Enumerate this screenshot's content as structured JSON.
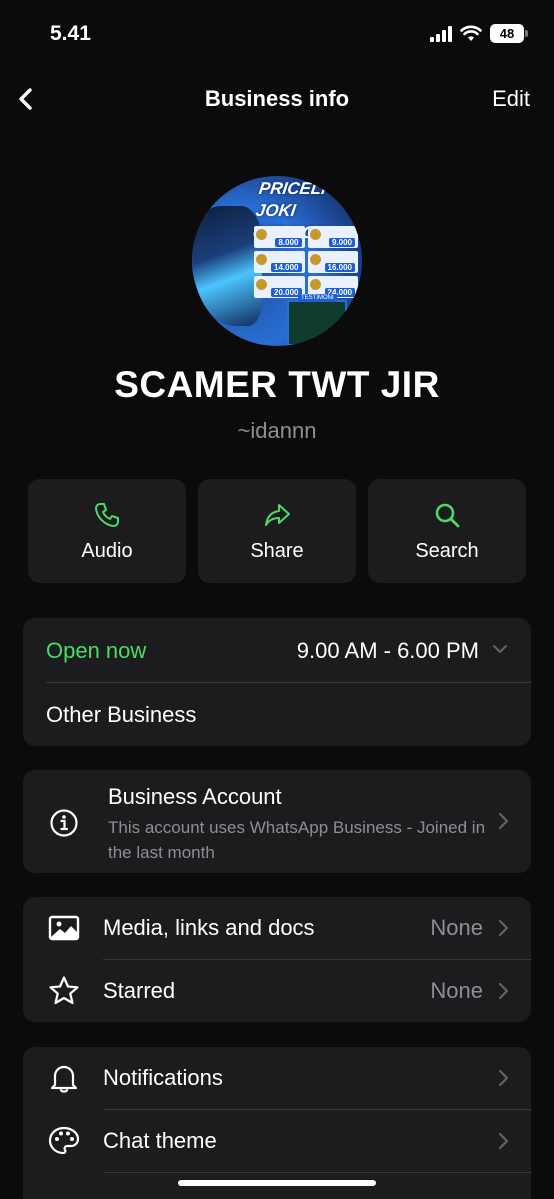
{
  "status_bar": {
    "time": "5.41",
    "battery": "48"
  },
  "nav": {
    "back_icon": "chevron-left-icon",
    "title": "Business info",
    "edit_label": "Edit"
  },
  "avatar": {
    "banner_line1": "PRICELI",
    "banner_line2": "JOKI GENDON",
    "prices": [
      "8.000",
      "9.000",
      "14.000",
      "16.000",
      "20.000",
      "24.000"
    ],
    "footer_tag": "TESTIMONI"
  },
  "profile": {
    "name": "SCAMER TWT JIR",
    "handle": "~idannn"
  },
  "actions": [
    {
      "label": "Audio",
      "icon": "phone-icon"
    },
    {
      "label": "Share",
      "icon": "share-arrow-icon"
    },
    {
      "label": "Search",
      "icon": "search-icon"
    }
  ],
  "hours": {
    "status": "Open now",
    "time": "9.00 AM - 6.00 PM",
    "category": "Other Business"
  },
  "account": {
    "title": "Business Account",
    "subtitle": "This account uses WhatsApp Business - Joined in the last month",
    "icon": "info-icon"
  },
  "media_list": [
    {
      "label": "Media, links and docs",
      "value": "None",
      "icon": "image-icon"
    },
    {
      "label": "Starred",
      "value": "None",
      "icon": "star-icon"
    }
  ],
  "settings_list": [
    {
      "label": "Notifications",
      "icon": "bell-icon"
    },
    {
      "label": "Chat theme",
      "icon": "palette-icon"
    }
  ],
  "colors": {
    "accent_green": "#4cd964",
    "card_bg": "#1c1c1e",
    "secondary_text": "#8e8e93"
  }
}
